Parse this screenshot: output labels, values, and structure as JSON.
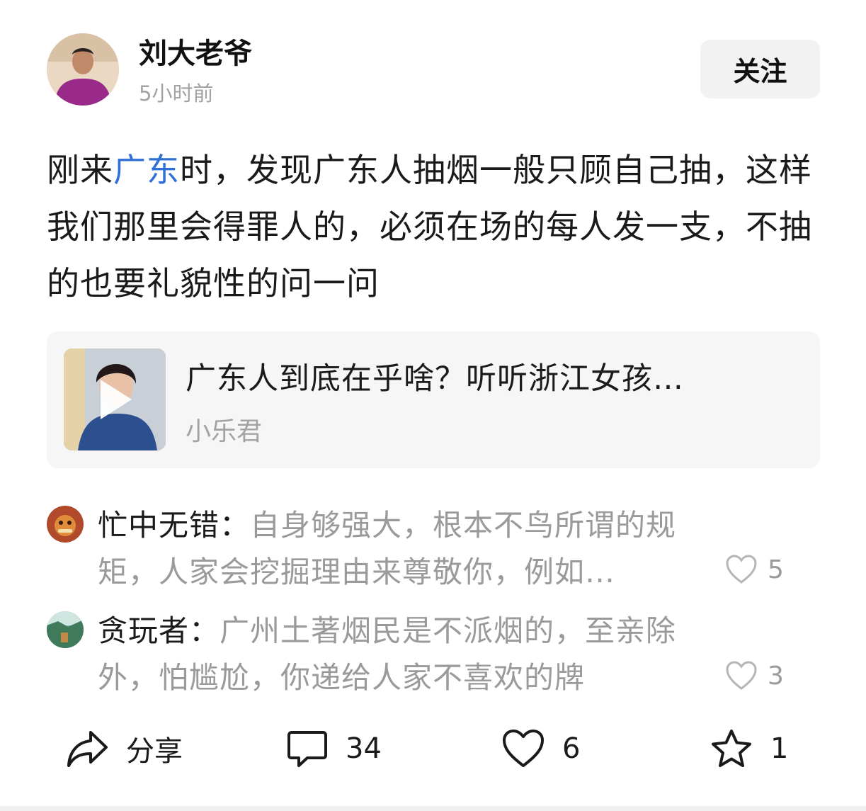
{
  "author": {
    "name": "刘大老爷",
    "time": "5小时前",
    "follow_label": "关注"
  },
  "post": {
    "text_before": "刚来",
    "topic": "广东",
    "text_after": "时，发现广东人抽烟一般只顾自己抽，这样我们那里会得罪人的，必须在场的每人发一支，不抽的也要礼貌性的问一问"
  },
  "video_card": {
    "title": "广东人到底在乎啥？听听浙江女孩…",
    "source": "小乐君"
  },
  "comments": [
    {
      "user": "忙中无错：",
      "text": "自身够强大，根本不鸟所谓的规矩，人家会挖掘理由来尊敬你，例如…",
      "likes": "5"
    },
    {
      "user": "贪玩者：",
      "text": "广州土著烟民是不派烟的，至亲除外，怕尴尬，你递给人家不喜欢的牌",
      "likes": "3"
    }
  ],
  "actions": {
    "share_label": "分享",
    "comment_count": "34",
    "like_count": "6",
    "favorite_count": "1"
  },
  "colors": {
    "link": "#2f6fd8",
    "muted": "#9a9a9a",
    "card_bg": "#f6f6f7",
    "button_bg": "#f2f2f2"
  },
  "icons": [
    "share-icon",
    "comment-icon",
    "heart-icon",
    "star-icon",
    "play-icon"
  ]
}
